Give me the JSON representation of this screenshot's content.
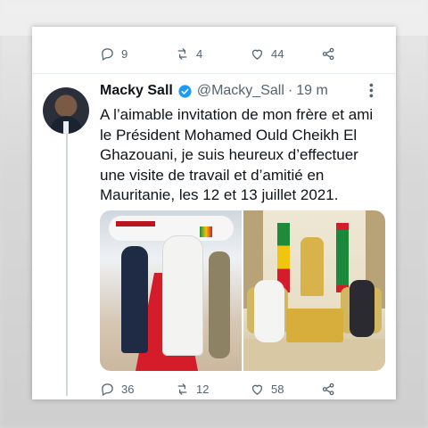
{
  "previous_tweet": {
    "reply_count": "9",
    "retweet_count": "4",
    "like_count": "44"
  },
  "tweet": {
    "author_name": "Macky Sall",
    "handle": "@Macky_Sall",
    "separator": "·",
    "time": "19 m",
    "text": "A l’aimable invitation de mon frère et ami le Président Mohamed Ould Cheikh El Ghazouani, je suis heureux d’effectuer une visite de travail et d’amitié en Mauritanie, les 12 et 13 juillet 2021.",
    "reply_count": "36",
    "retweet_count": "12",
    "like_count": "58"
  },
  "icons": {
    "reply": "reply-icon",
    "retweet": "retweet-icon",
    "like": "heart-icon",
    "share": "share-icon",
    "verified": "verified-badge-icon",
    "more": "more-options-icon"
  },
  "colors": {
    "verified_blue": "#1d9bf0",
    "icon_gray": "#536471",
    "text_dark": "#0f1419"
  }
}
